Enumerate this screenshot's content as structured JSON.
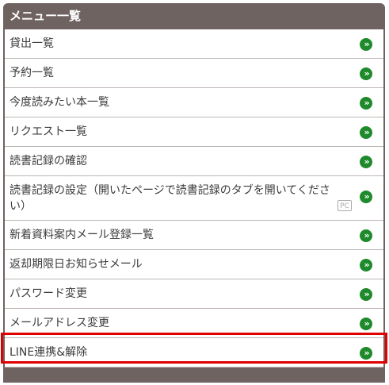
{
  "menu": {
    "title": "メニュー一覧",
    "items": [
      {
        "label": "貸出一覧",
        "icon": "chevron-double-right-icon"
      },
      {
        "label": "予約一覧",
        "icon": "chevron-double-right-icon"
      },
      {
        "label": "今度読みたい本一覧",
        "icon": "chevron-double-right-icon"
      },
      {
        "label": "リクエスト一覧",
        "icon": "chevron-double-right-icon"
      },
      {
        "label": "読書記録の確認",
        "icon": "chevron-double-right-icon"
      },
      {
        "label": "読書記録の設定（開いたページで読書記録のタブを開いてください）",
        "icon": "chevron-double-right-icon",
        "badge": "PC"
      },
      {
        "label": "新着資料案内メール登録一覧",
        "icon": "chevron-double-right-icon"
      },
      {
        "label": "返却期限日お知らせメール",
        "icon": "chevron-double-right-icon"
      },
      {
        "label": "パスワード変更",
        "icon": "chevron-double-right-icon"
      },
      {
        "label": "メールアドレス変更",
        "icon": "chevron-double-right-icon"
      },
      {
        "label": "LINE連携&解除",
        "icon": "chevron-double-right-icon"
      }
    ],
    "arrow_glyph": "»"
  },
  "colors": {
    "header_bg": "#6e6360",
    "arrow": "#1f8a2b",
    "highlight": "#e00000"
  }
}
